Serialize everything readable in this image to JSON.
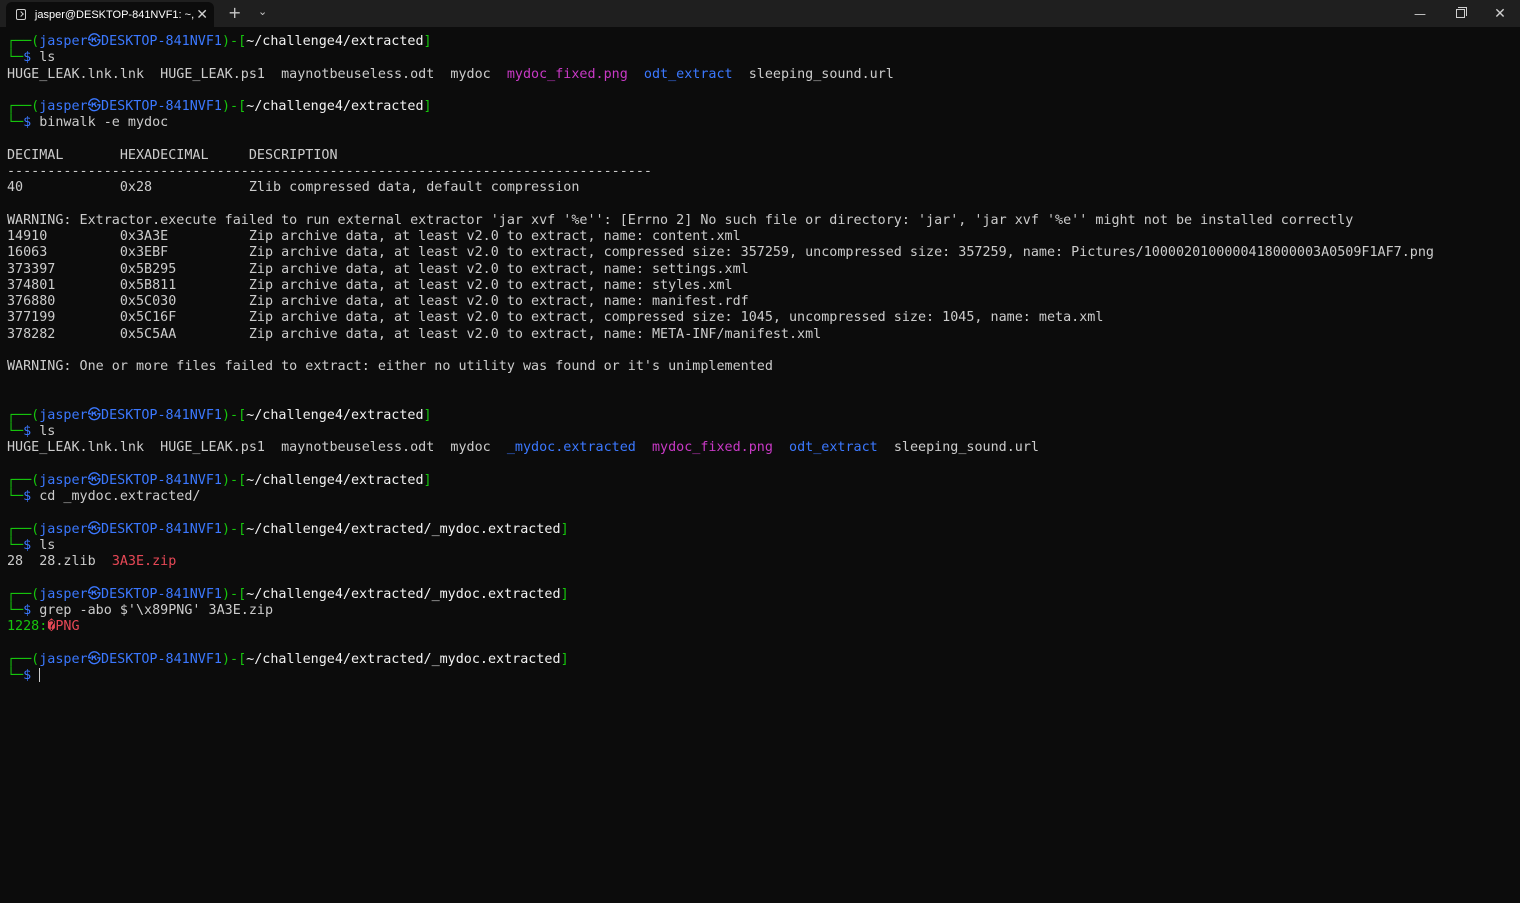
{
  "window": {
    "tab_title": "jasper@DESKTOP-841NVF1: ~,",
    "tab_close": "✕",
    "new_tab": "+",
    "dropdown": "⌄",
    "minimize": "—",
    "close": "✕",
    "icons": [
      "terminal-icon",
      "close-icon",
      "plus-icon",
      "chevron-down-icon",
      "minimize-icon",
      "maximize-icon",
      "close-window-icon"
    ]
  },
  "colors": {
    "background": "#0c0c0c",
    "prompt_green": "#16c60c",
    "prompt_blue": "#3b78ff",
    "directory_blue": "#3b78ff",
    "image_magenta": "#c839c5",
    "archive_red": "#e74856",
    "text": "#cccccc"
  },
  "prompt": {
    "open": "┌──(",
    "user": "jasper",
    "at": "㉿",
    "host": "DESKTOP-841NVF1",
    "mid": ")-[",
    "close": "]",
    "second": "└─",
    "dollar": "$ "
  },
  "blocks": {
    "p1": {
      "path": "~/challenge4/extracted",
      "cmd": "ls"
    },
    "ls1": {
      "f1": "HUGE_LEAK.lnk.lnk  HUGE_LEAK.ps1  maynotbeuseless.odt  mydoc  ",
      "f2": "mydoc_fixed.png",
      "sep": "  ",
      "f3": "odt_extract",
      "f4": "  sleeping_sound.url"
    },
    "p2": {
      "path": "~/challenge4/extracted",
      "cmd": "binwalk -e mydoc"
    },
    "binwalk": {
      "header": "DECIMAL       HEXADECIMAL     DESCRIPTION",
      "rule": "--------------------------------------------------------------------------------",
      "row1": "40            0x28            Zlib compressed data, default compression",
      "warning1": "WARNING: Extractor.execute failed to run external extractor 'jar xvf '%e'': [Errno 2] No such file or directory: 'jar', 'jar xvf '%e'' might not be installed correctly",
      "rows": [
        "14910         0x3A3E          Zip archive data, at least v2.0 to extract, name: content.xml",
        "16063         0x3EBF          Zip archive data, at least v2.0 to extract, compressed size: 357259, uncompressed size: 357259, name: Pictures/1000020100000418000003A0509F1AF7.png",
        "373397        0x5B295         Zip archive data, at least v2.0 to extract, name: settings.xml",
        "374801        0x5B811         Zip archive data, at least v2.0 to extract, name: styles.xml",
        "376880        0x5C030         Zip archive data, at least v2.0 to extract, name: manifest.rdf",
        "377199        0x5C16F         Zip archive data, at least v2.0 to extract, compressed size: 1045, uncompressed size: 1045, name: meta.xml",
        "378282        0x5C5AA         Zip archive data, at least v2.0 to extract, name: META-INF/manifest.xml"
      ],
      "warning2": "WARNING: One or more files failed to extract: either no utility was found or it's unimplemented"
    },
    "p3": {
      "path": "~/challenge4/extracted",
      "cmd": "ls"
    },
    "ls2": {
      "f1": "HUGE_LEAK.lnk.lnk  HUGE_LEAK.ps1  maynotbeuseless.odt  mydoc  ",
      "f2": "_mydoc.extracted",
      "sep1": "  ",
      "f3": "mydoc_fixed.png",
      "sep2": "  ",
      "f4": "odt_extract",
      "f5": "  sleeping_sound.url"
    },
    "p4": {
      "path": "~/challenge4/extracted",
      "cmd": "cd _mydoc.extracted/"
    },
    "p5": {
      "path": "~/challenge4/extracted/_mydoc.extracted",
      "cmd": "ls"
    },
    "ls3": {
      "f1": "28  28.zlib  ",
      "f2": "3A3E.zip"
    },
    "p6": {
      "path": "~/challenge4/extracted/_mydoc.extracted",
      "cmd": "grep -abo $'\\x89PNG' 3A3E.zip"
    },
    "grep": {
      "offset": "1228:",
      "match": "�PNG"
    },
    "p7": {
      "path": "~/challenge4/extracted/_mydoc.extracted",
      "cmd": ""
    }
  }
}
